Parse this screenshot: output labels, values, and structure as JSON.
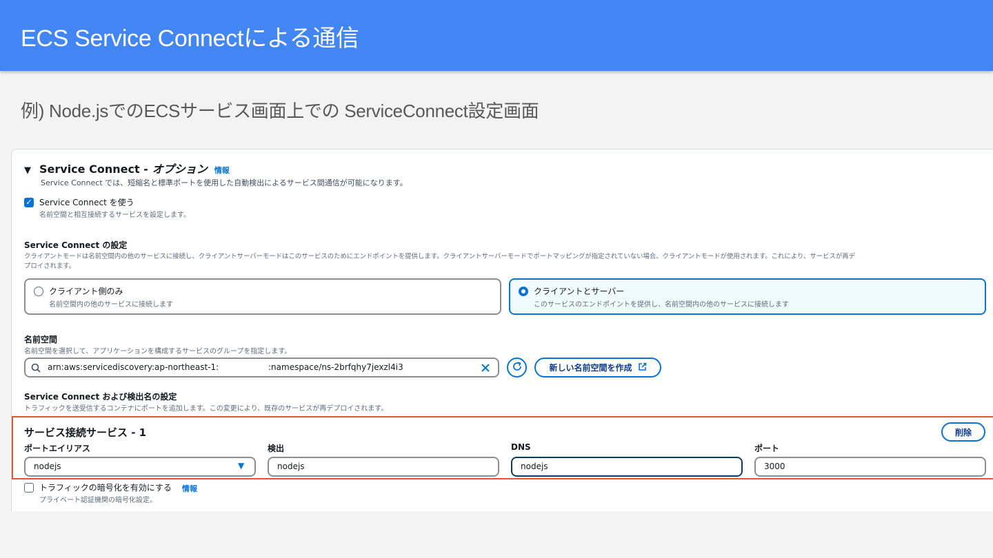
{
  "slide": {
    "title": "ECS Service Connectによる通信",
    "subtitle": "例) Node.jsでのECSサービス画面上での ServiceConnect設定画面"
  },
  "panel": {
    "header": {
      "title": "Service Connect - ",
      "title_italic": "オプション",
      "info": "情報",
      "description": "Service Connect では、短縮名と標準ポートを使用した自動検出によるサービス間通信が可能になります。"
    },
    "use_checkbox": {
      "checked": true,
      "label": "Service Connect を使う",
      "description": "名前空間と相互接続するサービスを設定します。"
    },
    "config": {
      "heading": "Service Connect の設定",
      "description_line1": "クライアントモードは名前空間内の他のサービスに接続し、クライアントサーバーモードはこのサービスのためにエンドポイントを提供します。クライアントサーバーモードでポートマッピングが指定されていない場合、クライアントモードが使用されます。これにより、サービスが再デ",
      "description_line2": "プロイされます。",
      "options": [
        {
          "label": "クライアント側のみ",
          "description": "名前空間内の他のサービスに接続します",
          "selected": false
        },
        {
          "label": "クライアントとサーバー",
          "description": "このサービスのエンドポイントを提供し、名前空間内の他のサービスに接続します",
          "selected": true
        }
      ]
    },
    "namespace": {
      "heading": "名前空間",
      "description": "名前空間を選択して、アプリケーションを構成するサービスのグループを指定します。",
      "value_prefix": "arn:aws:servicediscovery:ap-northeast-1:",
      "value_suffix": ":namespace/ns-2brfqhy7jexzl4i3",
      "create_button": "新しい名前空間を作成"
    },
    "discovery": {
      "heading": "Service Connect および検出名の設定",
      "description": "トラフィックを送受信するコンテナにポートを追加します。この変更により、既存のサービスが再デプロイされます。"
    },
    "service": {
      "title": "サービス接続サービス - 1",
      "delete_button": "削除",
      "fields": {
        "port_alias": {
          "label": "ポートエイリアス",
          "value": "nodejs"
        },
        "discovery": {
          "label": "検出",
          "value": "nodejs"
        },
        "dns": {
          "label": "DNS",
          "value": "nodejs"
        },
        "port": {
          "label": "ポート",
          "value": "3000"
        }
      }
    },
    "encryption": {
      "checked": false,
      "label": "トラフィックの暗号化を有効にする",
      "info": "情報",
      "description": "プライベート認証機関の暗号化設定。"
    }
  },
  "colors": {
    "title_bar": "#4285f4",
    "accent": "#0972d3",
    "highlight": "#e8542a"
  }
}
